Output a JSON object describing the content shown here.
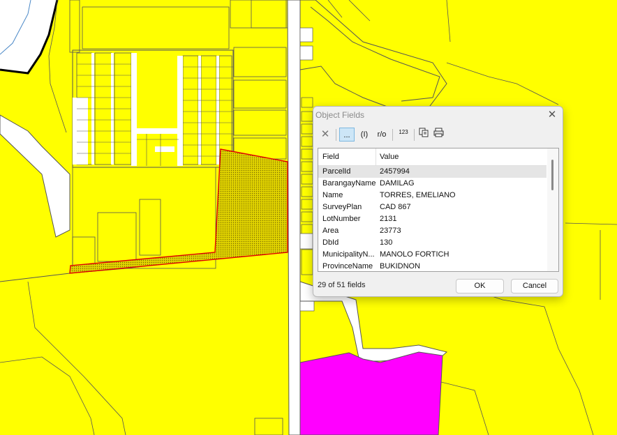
{
  "map": {
    "colors": {
      "parcel": "#ffff00",
      "parcel_outline": "#555555",
      "road": "#ffffff",
      "selected_outline": "#e00000",
      "special_zone": "#ff00ff",
      "water_line": "#4a88c7"
    }
  },
  "dialog": {
    "title": "Object Fields",
    "close_icon": "close-icon",
    "toolbar": {
      "delete_icon": "delete-x-icon",
      "ellipsis_label": "...",
      "info_label": "(I)",
      "readonly_label": "r/o",
      "numbering_label": "123",
      "copy_icon": "copy-icon",
      "print_icon": "print-icon"
    },
    "columns": {
      "field": "Field",
      "value": "Value"
    },
    "rows": [
      {
        "field": "ParcelId",
        "value": "2457994"
      },
      {
        "field": "BarangayName",
        "value": "DAMILAG"
      },
      {
        "field": "Name",
        "value": "TORRES, EMELIANO"
      },
      {
        "field": "SurveyPlan",
        "value": "CAD 867"
      },
      {
        "field": "LotNumber",
        "value": "2131"
      },
      {
        "field": "Area",
        "value": "23773"
      },
      {
        "field": "DbId",
        "value": "130"
      },
      {
        "field": "MunicipalityN...",
        "value": "MANOLO FORTICH"
      },
      {
        "field": "ProvinceName",
        "value": "BUKIDNON"
      }
    ],
    "status": "29 of 51 fields",
    "ok_label": "OK",
    "cancel_label": "Cancel"
  }
}
